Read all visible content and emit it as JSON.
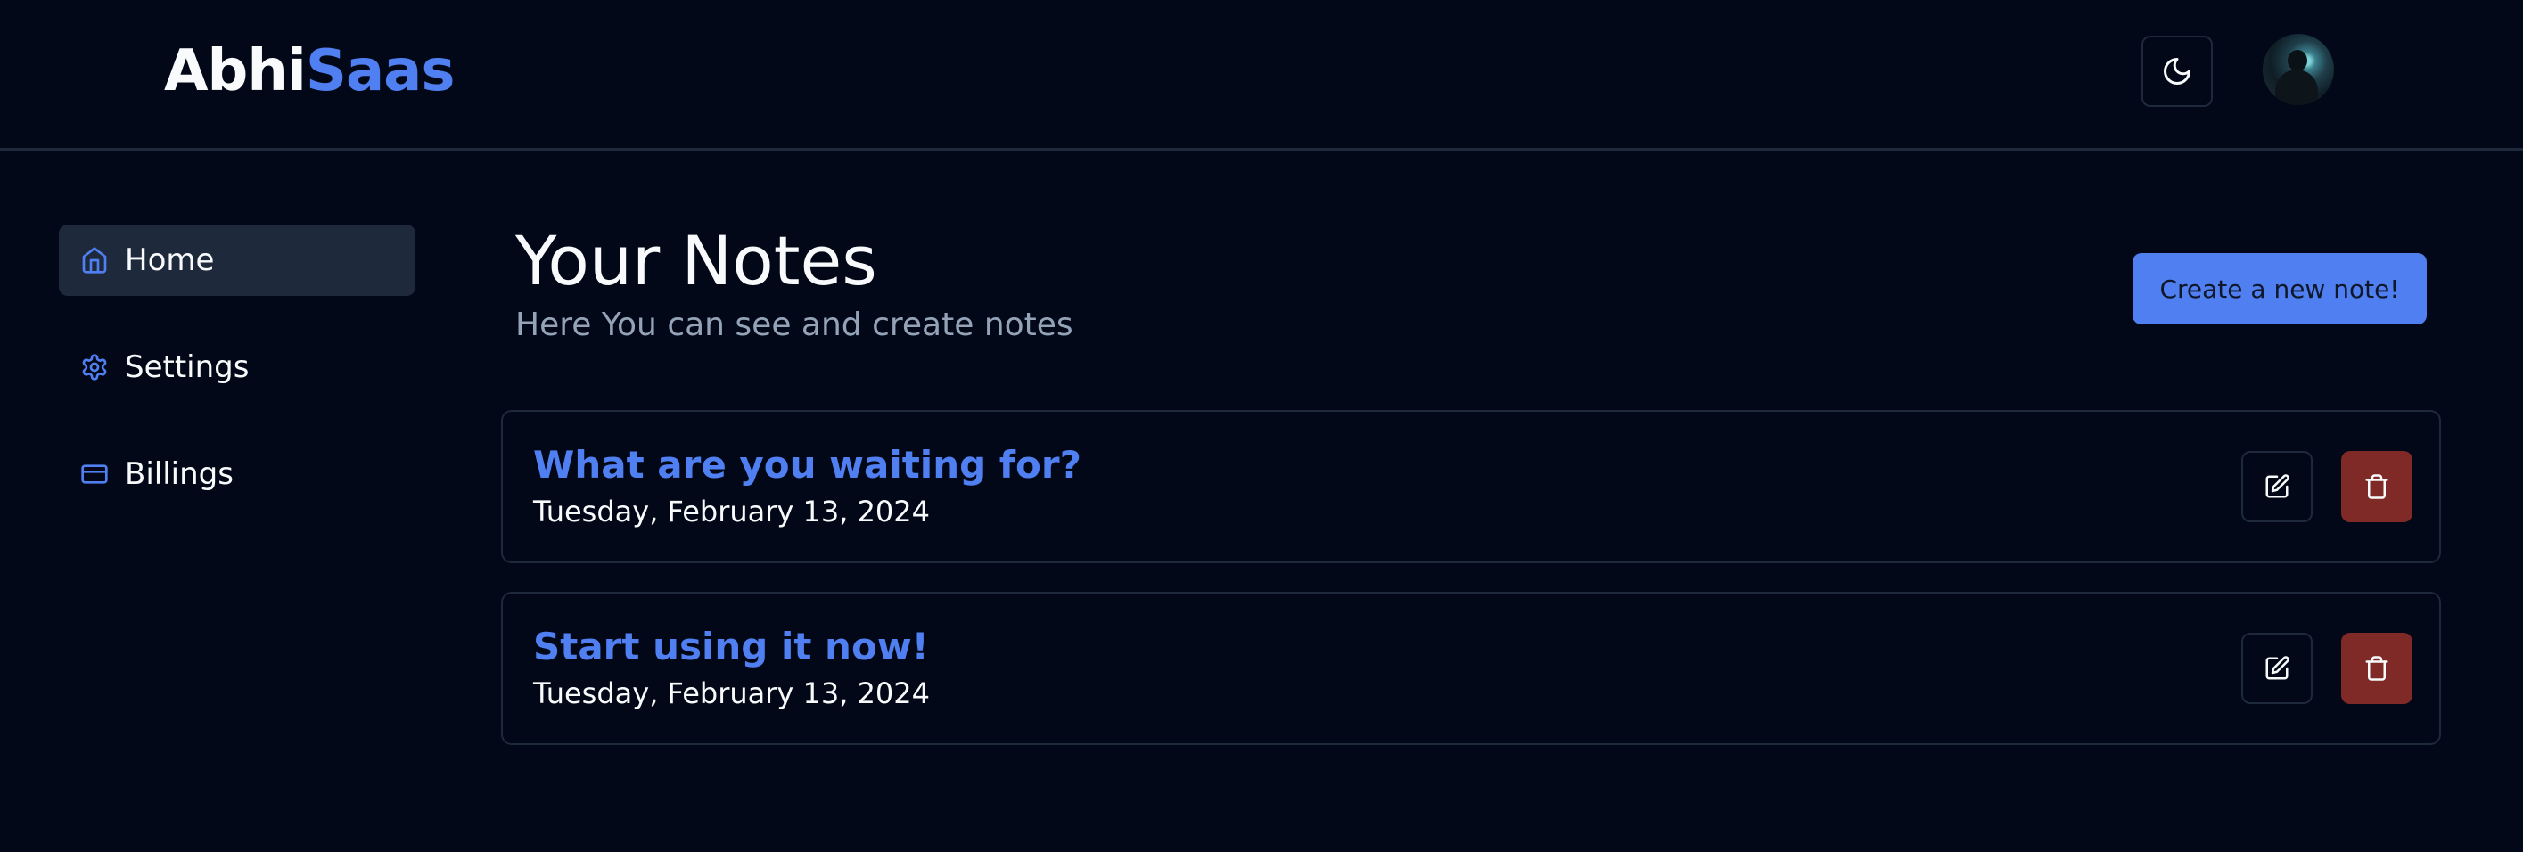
{
  "brand": {
    "part1": "Abhi",
    "part2": "Saas"
  },
  "header": {
    "theme_toggle_icon": "moon-icon",
    "avatar_label": "user-avatar"
  },
  "colors": {
    "accent": "#4f7ff0",
    "danger": "#7f2a26",
    "background": "#020817",
    "border": "#1e293b"
  },
  "sidebar": {
    "items": [
      {
        "label": "Home",
        "icon": "home-icon",
        "active": true
      },
      {
        "label": "Settings",
        "icon": "gear-icon",
        "active": false
      },
      {
        "label": "Billings",
        "icon": "credit-card-icon",
        "active": false
      }
    ]
  },
  "main": {
    "title": "Your Notes",
    "subtitle": "Here You can see and create notes",
    "create_button": "Create a new note!"
  },
  "notes": [
    {
      "title": "What are you waiting for?",
      "date": "Tuesday, February 13, 2024",
      "edit_icon": "edit-icon",
      "delete_icon": "trash-icon"
    },
    {
      "title": "Start using it now!",
      "date": "Tuesday, February 13, 2024",
      "edit_icon": "edit-icon",
      "delete_icon": "trash-icon"
    }
  ]
}
